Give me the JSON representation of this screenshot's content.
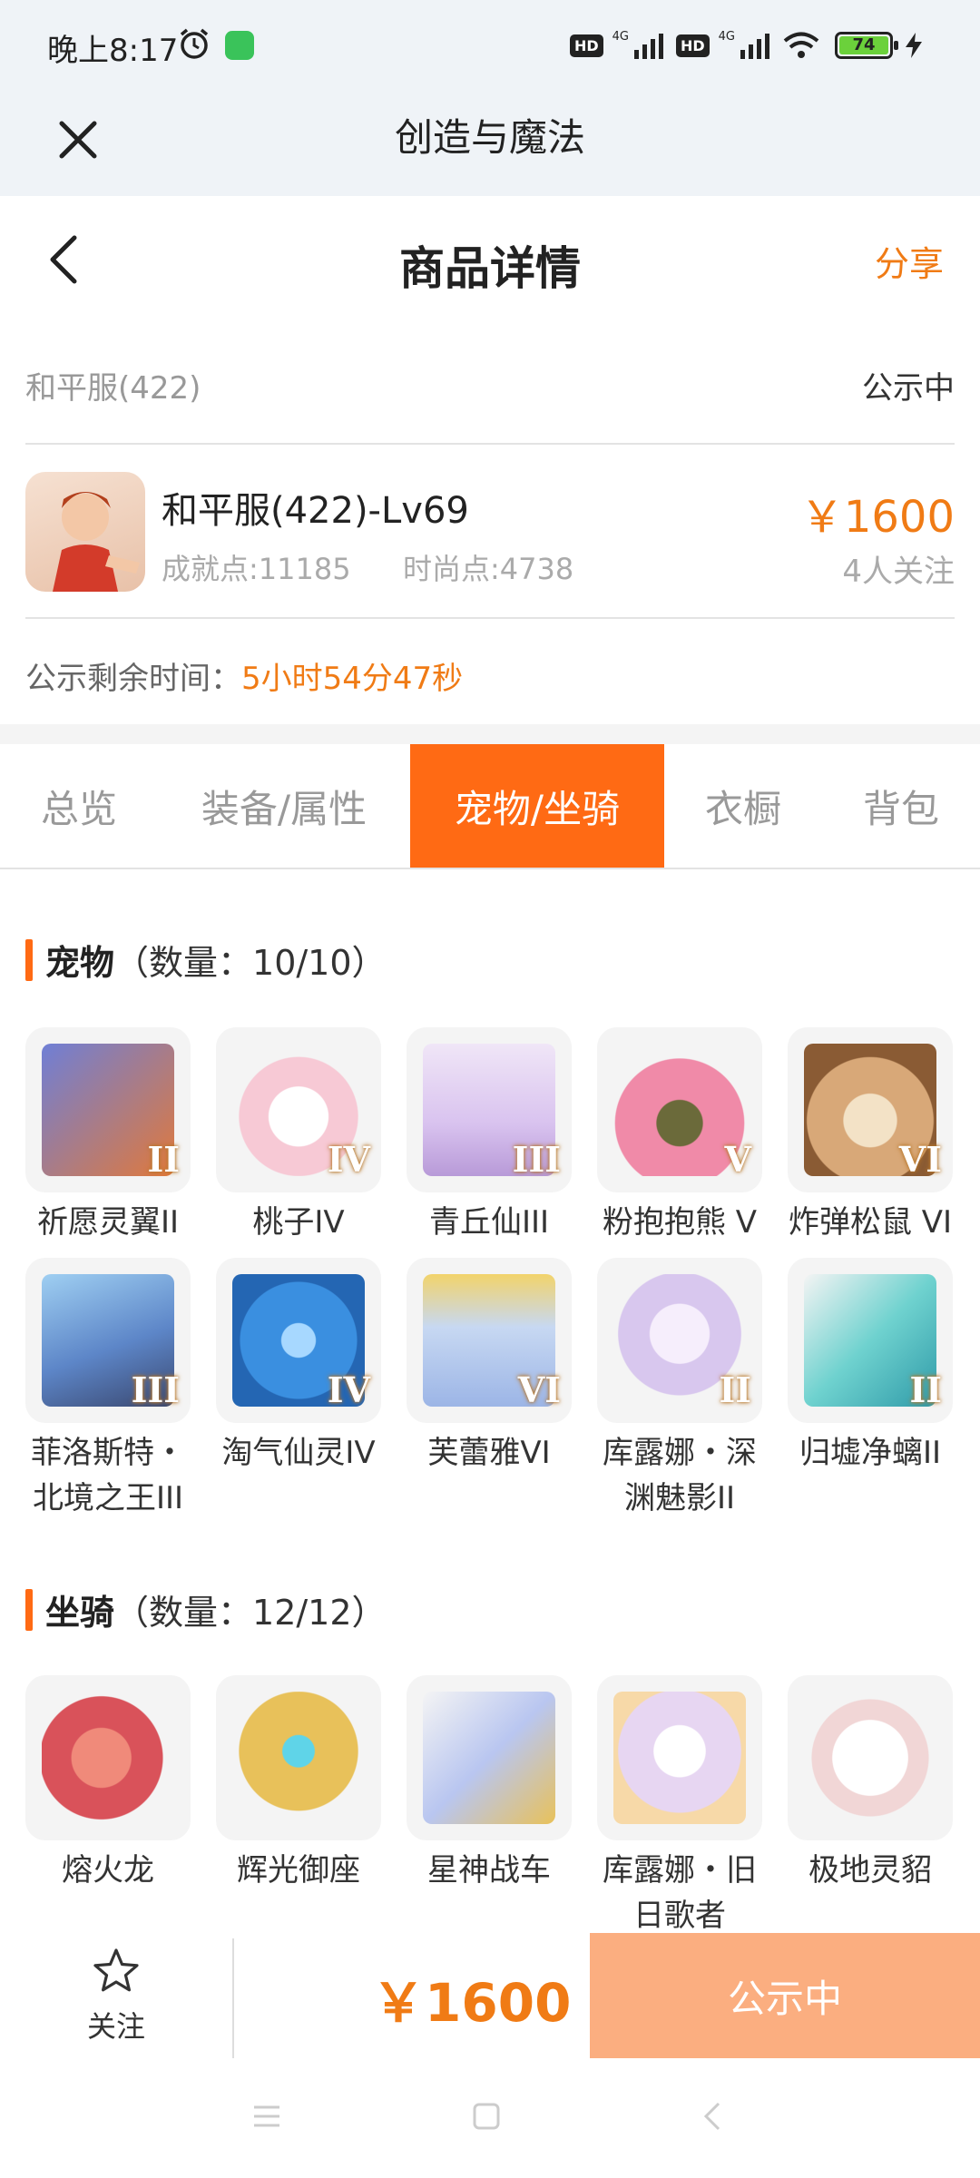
{
  "status_bar": {
    "time": "晚上8:17",
    "network1": "4G",
    "network2": "4G",
    "hd1": "HD",
    "hd2": "HD",
    "battery": "74"
  },
  "app_bar": {
    "title": "创造与魔法"
  },
  "page": {
    "title": "商品详情",
    "share": "分享"
  },
  "server": {
    "name": "和平服(422)",
    "status": "公示中"
  },
  "product": {
    "name": "和平服(422)-Lv69",
    "achievement": "成就点:11185",
    "fashion": "时尚点:4738",
    "price": "￥1600",
    "followers": "4人关注"
  },
  "countdown": {
    "label": "公示剩余时间：",
    "value": "5小时54分47秒"
  },
  "tabs": [
    {
      "label": "总览",
      "active": false
    },
    {
      "label": "装备/属性",
      "active": false
    },
    {
      "label": "宠物/坐骑",
      "active": true
    },
    {
      "label": "衣橱",
      "active": false
    },
    {
      "label": "背包",
      "active": false
    }
  ],
  "pets": {
    "title": "宠物",
    "count": "（数量：10/10）",
    "items": [
      {
        "name": "祈愿灵翼II",
        "rank": "II",
        "color": "#e0793c"
      },
      {
        "name": "桃子IV",
        "rank": "IV",
        "color": "#f7c9d5"
      },
      {
        "name": "青丘仙III",
        "rank": "III",
        "color": "#d9c3ef"
      },
      {
        "name": "粉抱抱熊 V",
        "rank": "V",
        "color": "#f08aa8"
      },
      {
        "name": "炸弹松鼠 VI",
        "rank": "VI",
        "color": "#d8a878"
      },
      {
        "name": "菲洛斯特・北境之王III",
        "rank": "III",
        "color": "#5d86c8"
      },
      {
        "name": "淘气仙灵IV",
        "rank": "IV",
        "color": "#3a8fe0"
      },
      {
        "name": "芙蕾雅VI",
        "rank": "VI",
        "color": "#c7d8f2"
      },
      {
        "name": "库露娜・深渊魅影II",
        "rank": "II",
        "color": "#d8c7ee"
      },
      {
        "name": "归墟净螭II",
        "rank": "II",
        "color": "#6fd2cf"
      }
    ]
  },
  "mounts": {
    "title": "坐骑",
    "count": "（数量：12/12）",
    "items": [
      {
        "name": "熔火龙",
        "color": "#d9525a"
      },
      {
        "name": "辉光御座",
        "color": "#e8c15a"
      },
      {
        "name": "星神战车",
        "color": "#b9c6f0"
      },
      {
        "name": "库露娜・旧日歌者",
        "color": "#e7d6f2"
      },
      {
        "name": "极地灵貂",
        "color": "#eeeeee"
      }
    ]
  },
  "bottom": {
    "follow": "关注",
    "price": "￥1600",
    "status": "公示中"
  }
}
